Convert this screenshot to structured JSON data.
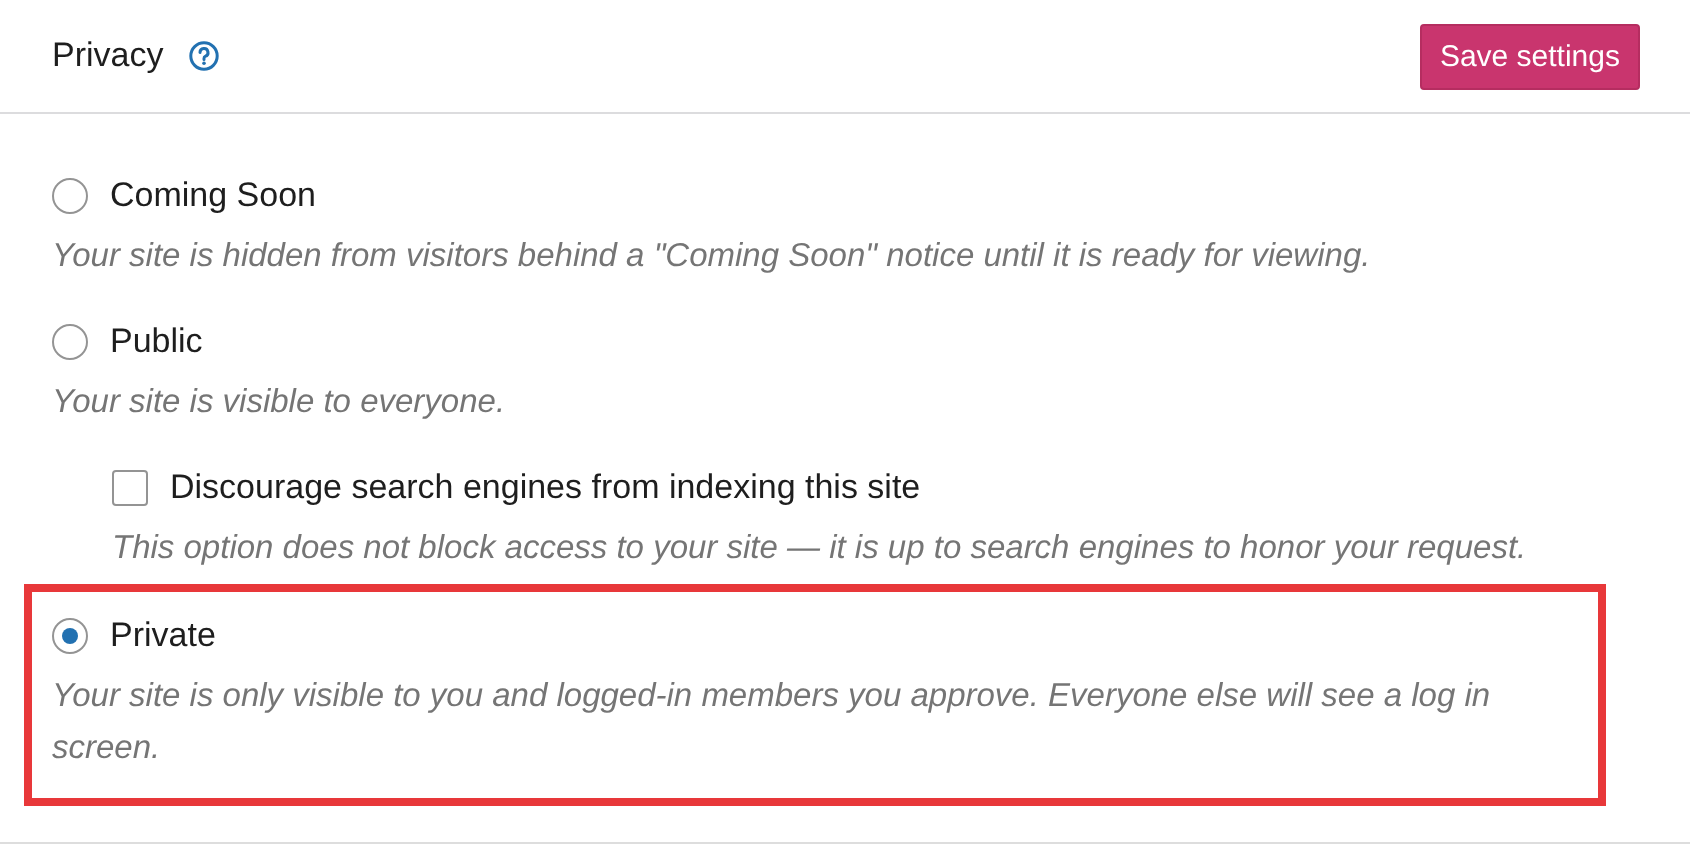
{
  "header": {
    "title": "Privacy",
    "save_button": "Save settings"
  },
  "options": [
    {
      "label": "Coming Soon",
      "selected": false,
      "highlighted": false,
      "description": "Your site is hidden from visitors behind a \"Coming Soon\" notice until it is ready for viewing."
    },
    {
      "label": "Public",
      "selected": false,
      "highlighted": false,
      "description": "Your site is visible to everyone.",
      "sub_option": {
        "label": "Discourage search engines from indexing this site",
        "checked": false,
        "description": "This option does not block access to your site — it is up to search engines to honor your request."
      }
    },
    {
      "label": "Private",
      "selected": true,
      "highlighted": true,
      "description": "Your site is only visible to you and logged-in members you approve. Everyone else will see a log in screen."
    }
  ]
}
